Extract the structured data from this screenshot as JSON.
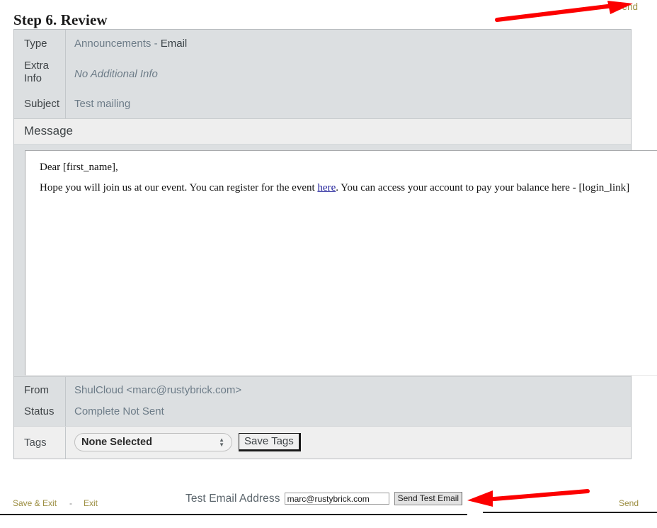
{
  "header": {
    "title": "Step 6. Review",
    "send_label": "Send",
    "send_color": "#9c8e41"
  },
  "details": {
    "type": {
      "label": "Type",
      "value_primary": "Announcements",
      "value_separator": " - ",
      "value_secondary": "Email"
    },
    "extra_info": {
      "label": "Extra Info",
      "value": "No Additional Info"
    },
    "subject": {
      "label": "Subject",
      "value": "Test mailing"
    }
  },
  "message": {
    "section_label": "Message",
    "greeting": "Dear [first_name],",
    "body_part1": "Hope you will join us at our event. You can register for the event ",
    "body_link": "here",
    "body_part2": ". You can access your account to pay your balance here - [login_link]"
  },
  "meta": {
    "from": {
      "label": "From",
      "value": "ShulCloud <marc@rustybrick.com>"
    },
    "status": {
      "label": "Status",
      "value": "Complete Not Sent"
    },
    "tags": {
      "label": "Tags",
      "selected": "None Selected",
      "options": [
        "None Selected"
      ],
      "save_button": "Save Tags"
    }
  },
  "footer": {
    "save_and_exit": "Save & Exit",
    "separator": "-",
    "exit": "Exit",
    "test_email_label": "Test Email Address",
    "test_email_value": "marc@rustybrick.com",
    "test_email_placeholder": "Test Email Address",
    "send_test_button": "Send Test Email",
    "send_label": "Send"
  },
  "annotations": {
    "arrow_color": "#fc0000",
    "arrow_top_name": "arrow-pointing-to-send",
    "arrow_bottom_name": "arrow-pointing-to-send-test-email"
  }
}
